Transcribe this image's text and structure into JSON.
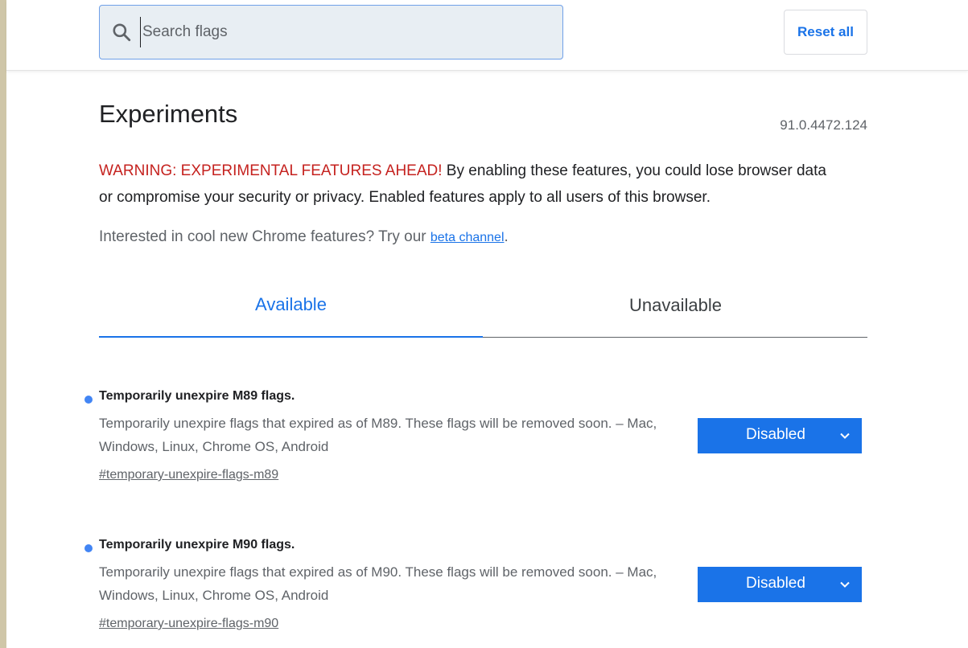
{
  "header": {
    "search_placeholder": "Search flags",
    "reset_label": "Reset all"
  },
  "main": {
    "title": "Experiments",
    "version": "91.0.4472.124",
    "warning_strong": "WARNING: EXPERIMENTAL FEATURES AHEAD!",
    "warning_text": " By enabling these features, you could lose browser data or compromise your security or privacy. Enabled features apply to all users of this browser.",
    "interest_text": "Interested in cool new Chrome features? Try our ",
    "beta_link": "beta channel",
    "interest_end": "."
  },
  "tabs": [
    {
      "label": "Available",
      "active": true
    },
    {
      "label": "Unavailable",
      "active": false
    }
  ],
  "flags": [
    {
      "name": "Temporarily unexpire M89 flags.",
      "description": "Temporarily unexpire flags that expired as of M89. These flags will be removed soon. – Mac, Windows, Linux, Chrome OS, Android",
      "permalink": "#temporary-unexpire-flags-m89",
      "state": "Disabled"
    },
    {
      "name": "Temporarily unexpire M90 flags.",
      "description": "Temporarily unexpire flags that expired as of M90. These flags will be removed soon. – Mac, Windows, Linux, Chrome OS, Android",
      "permalink": "#temporary-unexpire-flags-m90",
      "state": "Disabled"
    }
  ],
  "colors": {
    "accent": "#1a73e8",
    "warning": "#c5221f",
    "flag_dot": "#4285f4"
  }
}
